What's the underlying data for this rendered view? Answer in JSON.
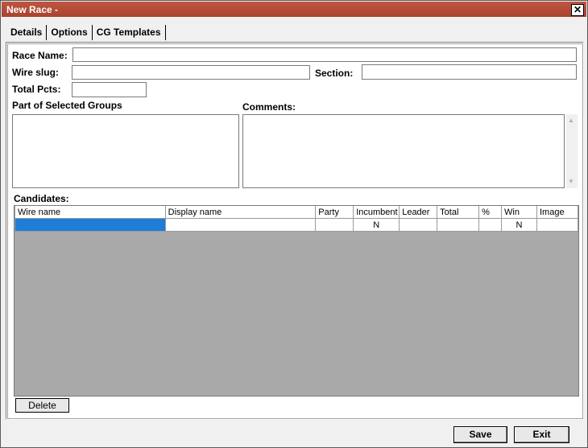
{
  "window": {
    "title": "New Race -",
    "close_glyph": "✕"
  },
  "tabs": [
    {
      "label": "Details"
    },
    {
      "label": "Options"
    },
    {
      "label": "CG Templates"
    }
  ],
  "form": {
    "race_name_label": "Race Name:",
    "race_name_value": "",
    "wire_slug_label": "Wire slug:",
    "wire_slug_value": "",
    "section_label": "Section:",
    "section_value": "",
    "total_pcts_label": "Total Pcts:",
    "total_pcts_value": "",
    "groups_label": "Part of Selected Groups",
    "comments_label": "Comments:",
    "candidates_label": "Candidates:"
  },
  "candidates_table": {
    "columns": [
      "Wire name",
      "Display name",
      "Party",
      "Incumbent",
      "Leader",
      "Total",
      "%",
      "Win",
      "Image"
    ],
    "rows": [
      [
        "",
        "",
        "",
        "N",
        "",
        "",
        "",
        "N",
        ""
      ]
    ]
  },
  "buttons": {
    "delete": "Delete",
    "save": "Save",
    "exit": "Exit"
  }
}
